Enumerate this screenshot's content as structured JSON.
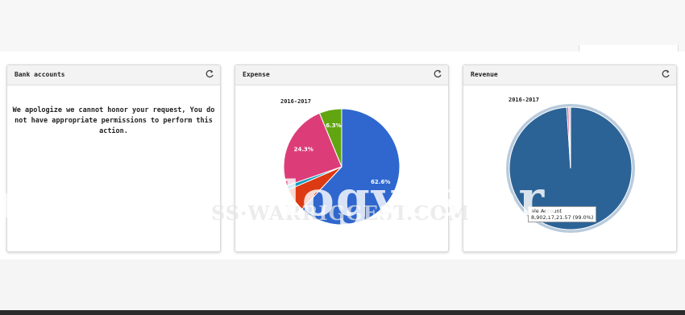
{
  "panels": {
    "bank": {
      "title": "Bank accounts",
      "message": "We apologize we cannot honor your request, You do not have appropriate permissions to perform this action."
    },
    "expense": {
      "title": "Expense",
      "period": "2016-2017",
      "slices": [
        {
          "value": 62.6,
          "label": "62.6%",
          "color": "#2f67cf"
        },
        {
          "value": 6.6,
          "label": "",
          "color": "#dd3a13"
        },
        {
          "value": 1.2,
          "label": "",
          "color": "#149fbd"
        },
        {
          "value": 24.3,
          "label": "24.3%",
          "color": "#dc3d79"
        },
        {
          "value": 6.3,
          "label": "6.3%",
          "color": "#61a511"
        }
      ]
    },
    "revenue": {
      "title": "Revenue",
      "period": "2016-2017",
      "slices": [
        {
          "value": 99.0,
          "label": "",
          "color": "#2c6397"
        },
        {
          "value": 0.5,
          "label": "",
          "color": "#dc3d79"
        },
        {
          "value": 0.5,
          "label": "",
          "color": "#b5c9db"
        }
      ],
      "tooltip_line1": "ale Account",
      "tooltip_line2": "8,902,17,21.57 (99.0%)"
    }
  },
  "watermark": {
    "big": "logyester.",
    "small": "SS·WARRIGGEST.COM"
  },
  "icons": {
    "refresh": "refresh-icon"
  }
}
